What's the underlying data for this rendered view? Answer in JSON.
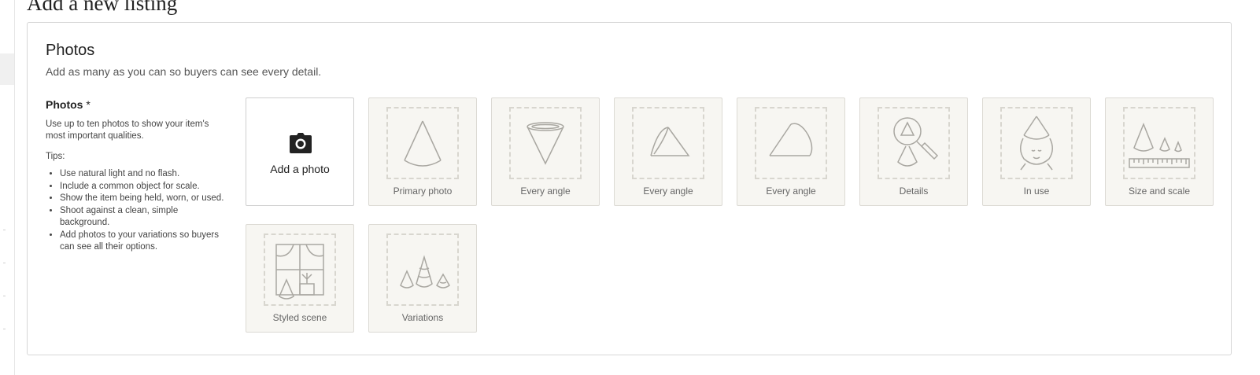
{
  "page": {
    "title": "Add a new listing"
  },
  "photos_section": {
    "title": "Photos",
    "subtitle": "Add as many as you can so buyers can see every detail.",
    "field_label": "Photos",
    "required_marker": "*",
    "description": "Use up to ten photos to show your item's most important qualities.",
    "tips_label": "Tips:",
    "tips": [
      "Use natural light and no flash.",
      "Include a common object for scale.",
      "Show the item being held, worn, or used.",
      "Shoot against a clean, simple background.",
      "Add photos to your variations so buyers can see all their options."
    ],
    "add_photo_label": "Add a photo",
    "slots": [
      {
        "caption": "Primary photo",
        "icon": "cone-upright-icon"
      },
      {
        "caption": "Every angle",
        "icon": "cone-inverted-icon"
      },
      {
        "caption": "Every angle",
        "icon": "cone-tilted-icon"
      },
      {
        "caption": "Every angle",
        "icon": "cone-side-icon"
      },
      {
        "caption": "Details",
        "icon": "magnifier-cone-icon"
      },
      {
        "caption": "In use",
        "icon": "cone-hat-face-icon"
      },
      {
        "caption": "Size and scale",
        "icon": "cones-ruler-icon"
      },
      {
        "caption": "Styled scene",
        "icon": "window-scene-icon"
      },
      {
        "caption": "Variations",
        "icon": "three-cones-icon"
      }
    ]
  },
  "colors": {
    "placeholder_bg": "#f7f6f2",
    "placeholder_border": "#dcdad4",
    "icon_stroke": "#a9a7a1",
    "text_primary": "#222222",
    "text_secondary": "#555555"
  }
}
